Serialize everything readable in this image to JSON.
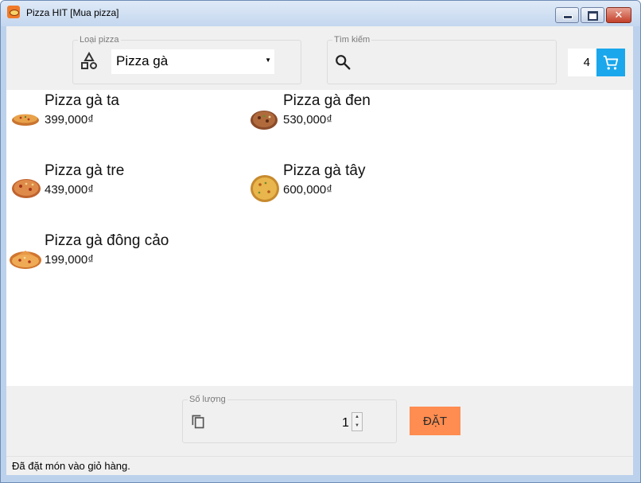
{
  "window": {
    "title": "Pizza HIT [Mua pizza]"
  },
  "filter": {
    "category_label": "Loại pizza",
    "category_value": "Pizza gà",
    "search_label": "Tìm kiếm",
    "search_value": ""
  },
  "cart": {
    "count": "4"
  },
  "products": [
    {
      "name": "Pizza gà ta",
      "price": "399,000₫"
    },
    {
      "name": "Pizza gà đen",
      "price": "530,000₫"
    },
    {
      "name": "Pizza gà tre",
      "price": "439,000₫"
    },
    {
      "name": "Pizza gà tây",
      "price": "600,000₫"
    },
    {
      "name": "Pizza gà đông cảo",
      "price": "199,000₫"
    }
  ],
  "order": {
    "quantity_label": "Số lượng",
    "quantity_value": "1",
    "order_button": "ĐẶT"
  },
  "status": {
    "message": "Đã đặt món vào giỏ hàng."
  },
  "colors": {
    "cart_button": "#1aa7ec",
    "order_button": "#ff8c50"
  },
  "icons": {
    "category": "shapes-icon",
    "search": "search-icon",
    "cart": "cart-icon",
    "quantity": "copy-icon"
  }
}
